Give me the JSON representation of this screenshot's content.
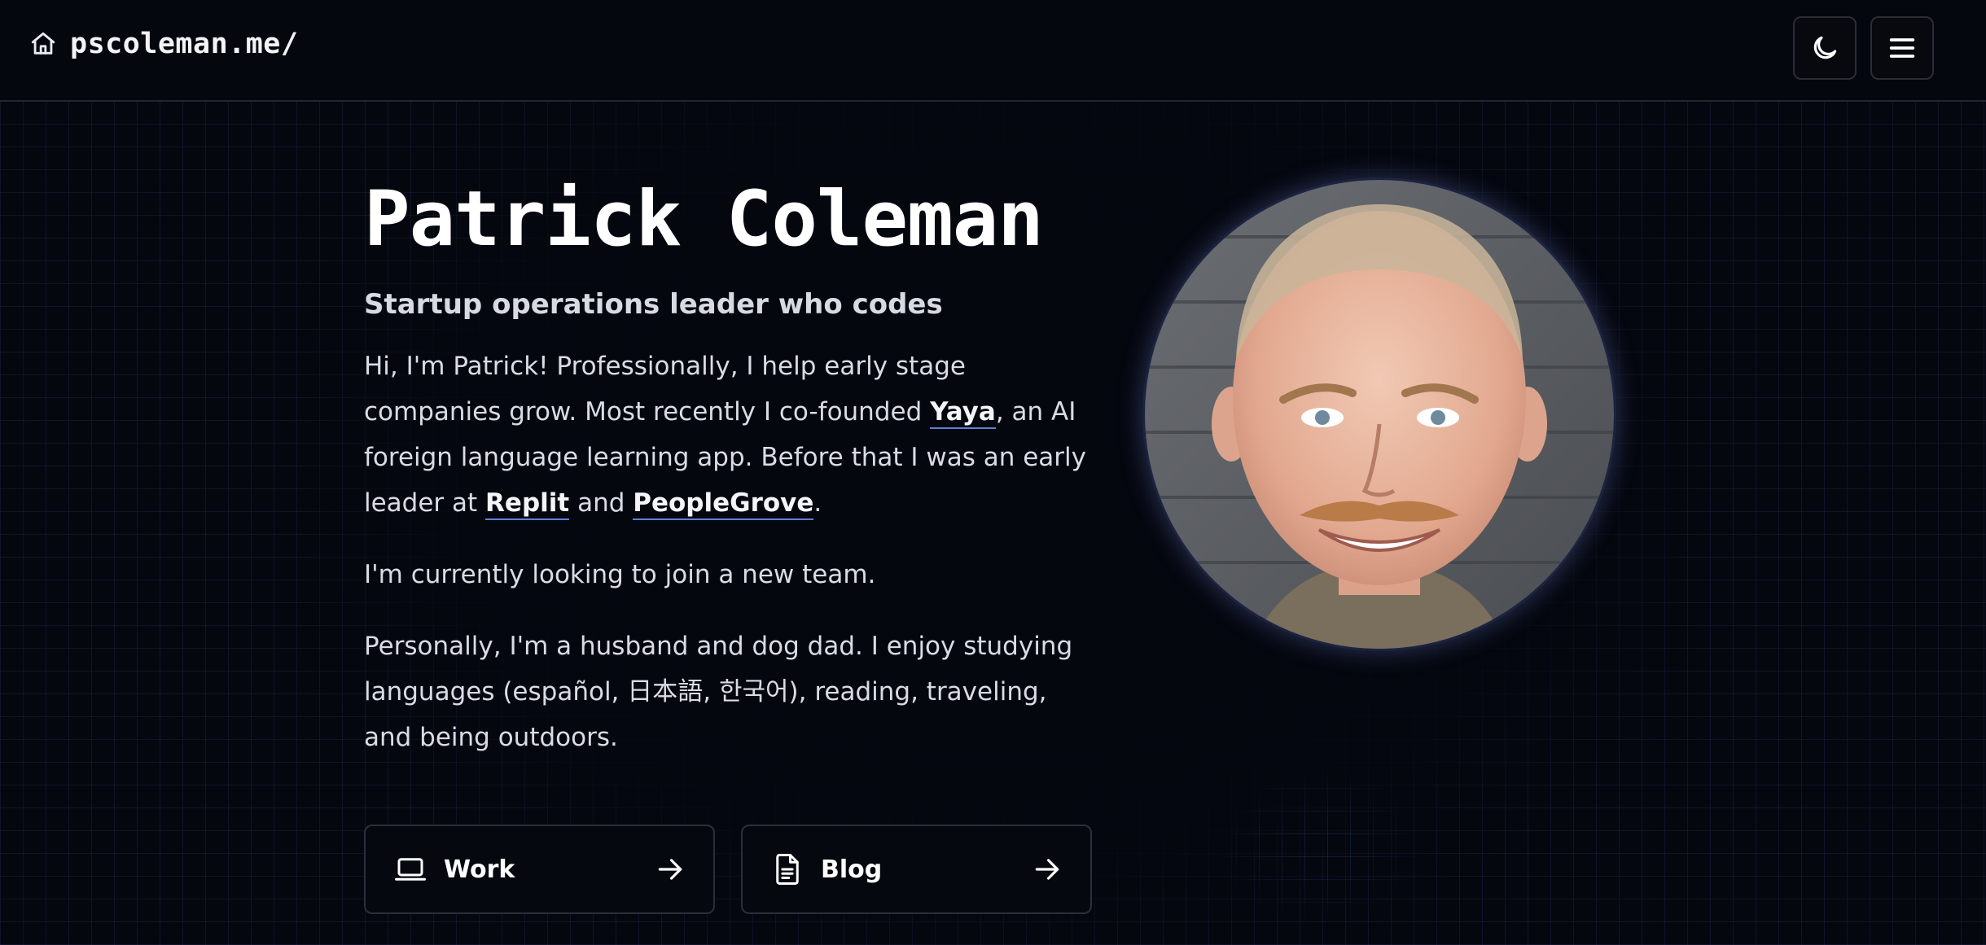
{
  "header": {
    "brand_text": "pscoleman.me/",
    "home_icon": "home-icon",
    "theme_toggle_icon": "moon-icon",
    "menu_icon": "hamburger-menu-icon"
  },
  "hero": {
    "name": "Patrick Coleman",
    "tagline": "Startup operations leader who codes",
    "intro": {
      "part1": "Hi, I'm Patrick! Professionally, I help early stage companies grow. Most recently I co-founded ",
      "link_yaya": "Yaya",
      "part2": ", an AI foreign language learning app. Before that I was an early leader at ",
      "link_replit": "Replit",
      "part3": " and ",
      "link_peoplegrove": "PeopleGrove",
      "part4": "."
    },
    "status": "I'm currently looking to join a new team.",
    "personal": "Personally, I'm a husband and dog dad. I enjoy studying languages (español, 日本語, 한국어), reading, traveling, and being outdoors."
  },
  "cards": [
    {
      "label": "Work",
      "icon": "laptop-icon",
      "arrow_icon": "arrow-right-icon"
    },
    {
      "label": "Blog",
      "icon": "document-icon",
      "arrow_icon": "arrow-right-icon"
    }
  ],
  "avatar": {
    "icon": "profile-photo"
  },
  "colors": {
    "background": "#05070f",
    "link_underline": "#5f7fd6",
    "text": "#d9dce4"
  }
}
